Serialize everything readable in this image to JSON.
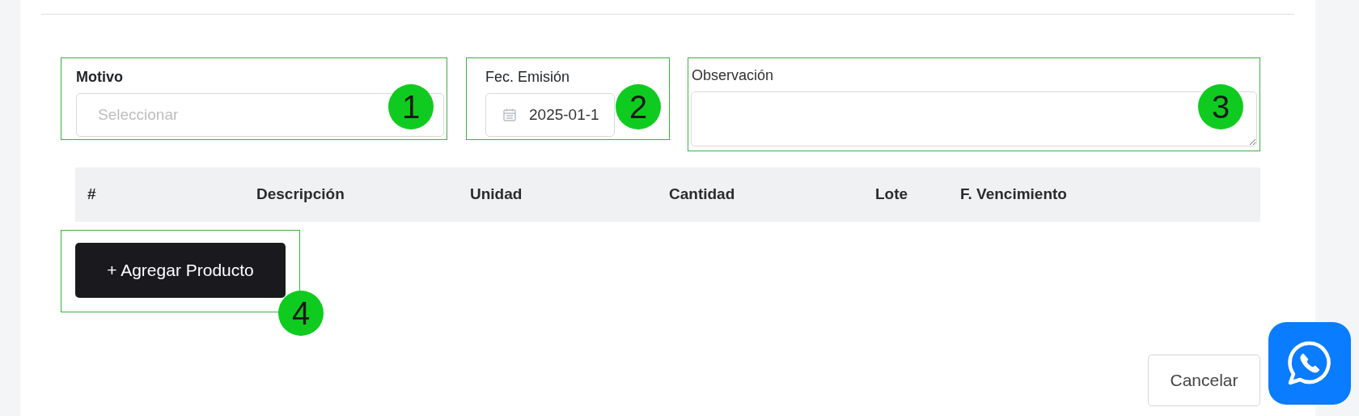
{
  "form": {
    "motivo": {
      "label": "Motivo",
      "placeholder": "Seleccionar",
      "callout": "1"
    },
    "fecha": {
      "label": "Fec. Emisión",
      "value": "2025-01-1",
      "callout": "2"
    },
    "observacion": {
      "label": "Observación",
      "callout": "3"
    }
  },
  "table": {
    "columns": [
      "#",
      "Descripción",
      "Unidad",
      "Cantidad",
      "Lote",
      "F. Vencimiento"
    ]
  },
  "add_button": {
    "label": "+ Agregar Producto",
    "callout": "4"
  },
  "cancel_button": {
    "label": "Cancelar"
  }
}
